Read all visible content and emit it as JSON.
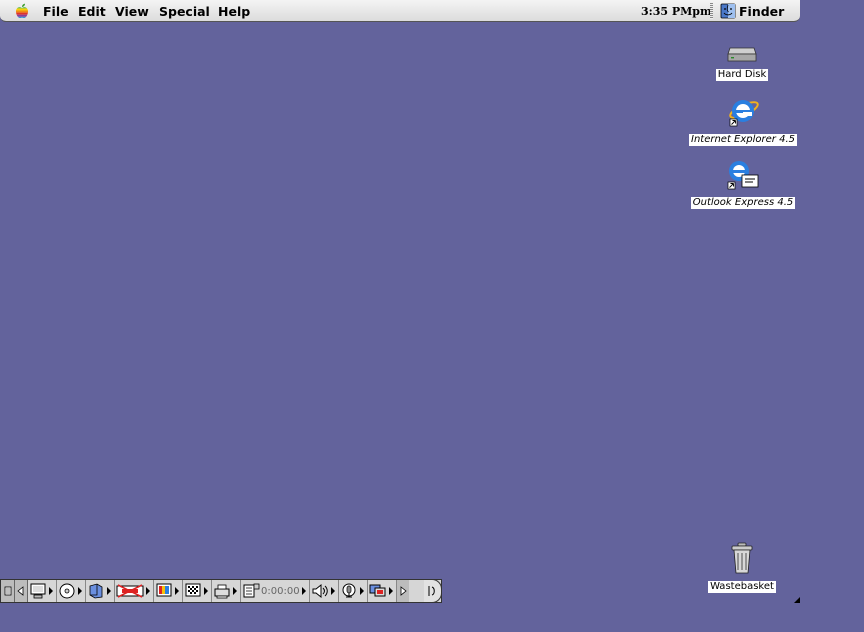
{
  "menubar": {
    "items": [
      {
        "label": "File"
      },
      {
        "label": "Edit"
      },
      {
        "label": "View"
      },
      {
        "label": "Special"
      },
      {
        "label": "Help"
      }
    ],
    "clock": "3:35 PMpm",
    "app_label": "Finder",
    "apple_icon": "apple-icon"
  },
  "desktop": {
    "background_color": "#63639c",
    "icons": [
      {
        "label": "Hard Disk",
        "icon": "hard-disk-icon"
      },
      {
        "label": "Internet Explorer 4.5",
        "icon": "internet-explorer-icon",
        "alias": true
      },
      {
        "label": "Outlook Express 4.5",
        "icon": "outlook-express-icon",
        "alias": true
      },
      {
        "label": "Wastebasket",
        "icon": "trash-icon"
      }
    ]
  },
  "control_strip": {
    "timer_text": "0:00:00",
    "modules": [
      "monitor-icon",
      "cd-icon",
      "file-sharing-icon",
      "remote-access-icon",
      "color-depth-icon",
      "resolution-icon",
      "printer-icon",
      "timer-icon",
      "sound-icon",
      "speech-icon",
      "monitors-icon"
    ]
  }
}
